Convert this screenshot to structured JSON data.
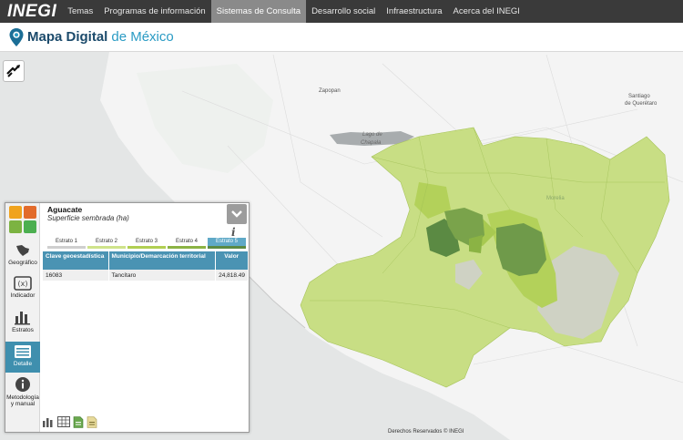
{
  "nav": {
    "logo": "INEGI",
    "items": [
      "Temas",
      "Programas de información",
      "Sistemas de Consulta",
      "Desarrollo social",
      "Infraestructura",
      "Acerca del INEGI"
    ],
    "active_index": 2
  },
  "header": {
    "title": "Mapa Digital",
    "subtitle": "de México"
  },
  "map": {
    "labels": {
      "zapopan": "Zapopan",
      "lago_line1": "Lago de",
      "lago_line2": "Chapala",
      "santiago_line1": "Santiago",
      "santiago_line2": "de Querétaro",
      "morelia": "Morelia"
    },
    "copyright": "Derechos Reservados © INEGI"
  },
  "panel": {
    "title": "Aguacate",
    "subtitle": "Superficie sembrada (ha)",
    "strata": [
      "Estrato 1",
      "Estrato 2",
      "Estrato 3",
      "Estrato 4",
      "Estrato 5"
    ],
    "active_stratum": 4,
    "strata_colors": [
      "#cfcfcf",
      "#cfe38a",
      "#b1cf52",
      "#8bb344",
      "#5b8a43"
    ],
    "table": {
      "headers": [
        "Clave geoestadística",
        "Municipio/Demarcación territorial",
        "Valor"
      ],
      "rows": [
        [
          "16083",
          "Tancítaro",
          "24,818.49"
        ]
      ]
    },
    "sidebar": {
      "geografico": "Geográfico",
      "indicador": "Indicador",
      "estratos": "Estratos",
      "detalle": "Detalle",
      "metodologia_line1": "Metodología",
      "metodologia_line2": "y manual"
    }
  },
  "colors": {
    "nav_bg": "#3a3a3a",
    "accent": "#3f8fae",
    "region_light": "#c8de84",
    "region_mid": "#b3d15a",
    "region_dark": "#6f9a4a"
  }
}
